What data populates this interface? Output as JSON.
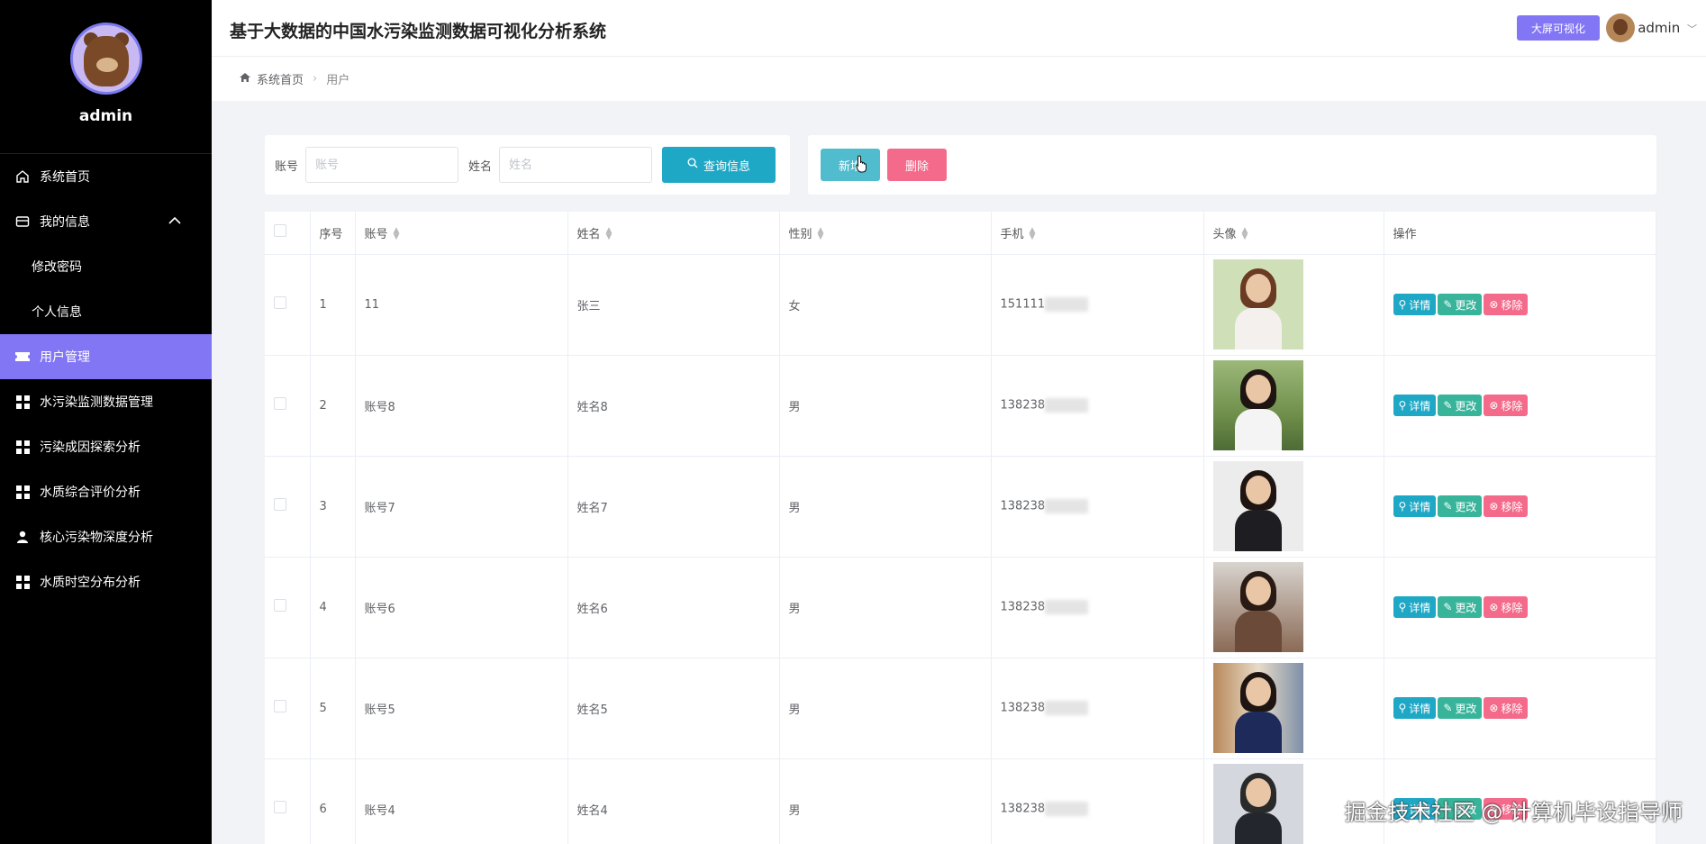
{
  "sidebar": {
    "username": "admin",
    "items": [
      {
        "label": "系统首页",
        "icon": "home-icon"
      },
      {
        "label": "我的信息",
        "icon": "wallet-icon"
      },
      {
        "label": "修改密码"
      },
      {
        "label": "个人信息"
      },
      {
        "label": "用户管理",
        "icon": "ticket-icon"
      },
      {
        "label": "水污染监测数据管理",
        "icon": "grid-icon"
      },
      {
        "label": "污染成因探索分析",
        "icon": "grid-icon"
      },
      {
        "label": "水质综合评价分析",
        "icon": "grid-icon"
      },
      {
        "label": "核心污染物深度分析",
        "icon": "user-icon"
      },
      {
        "label": "水质时空分布分析",
        "icon": "grid-icon"
      }
    ],
    "active_color": "#8376f5"
  },
  "header": {
    "title": "基于大数据的中国水污染监测数据可视化分析系统",
    "bigscreen_label": "大屏可视化",
    "user": "admin"
  },
  "breadcrumb": {
    "home": "系统首页",
    "current": "用户"
  },
  "search": {
    "account_label": "账号",
    "account_placeholder": "账号",
    "name_label": "姓名",
    "name_placeholder": "姓名",
    "query_label": "查询信息"
  },
  "actions": {
    "add_label": "新增",
    "delete_label": "删除"
  },
  "table": {
    "headers": [
      "序号",
      "账号",
      "姓名",
      "性别",
      "手机",
      "头像",
      "操作"
    ],
    "rows": [
      {
        "index": "1",
        "account": "11",
        "name": "张三",
        "gender": "女",
        "phone": "151111"
      },
      {
        "index": "2",
        "account": "账号8",
        "name": "姓名8",
        "gender": "男",
        "phone": "138238"
      },
      {
        "index": "3",
        "account": "账号7",
        "name": "姓名7",
        "gender": "男",
        "phone": "138238"
      },
      {
        "index": "4",
        "account": "账号6",
        "name": "姓名6",
        "gender": "男",
        "phone": "138238"
      },
      {
        "index": "5",
        "account": "账号5",
        "name": "姓名5",
        "gender": "男",
        "phone": "138238"
      },
      {
        "index": "6",
        "account": "账号4",
        "name": "姓名4",
        "gender": "男",
        "phone": "138238"
      }
    ],
    "ops": {
      "detail": "详情",
      "edit": "更改",
      "remove": "移除"
    }
  },
  "watermark": "掘金技术社区 @ 计算机毕设指导师"
}
